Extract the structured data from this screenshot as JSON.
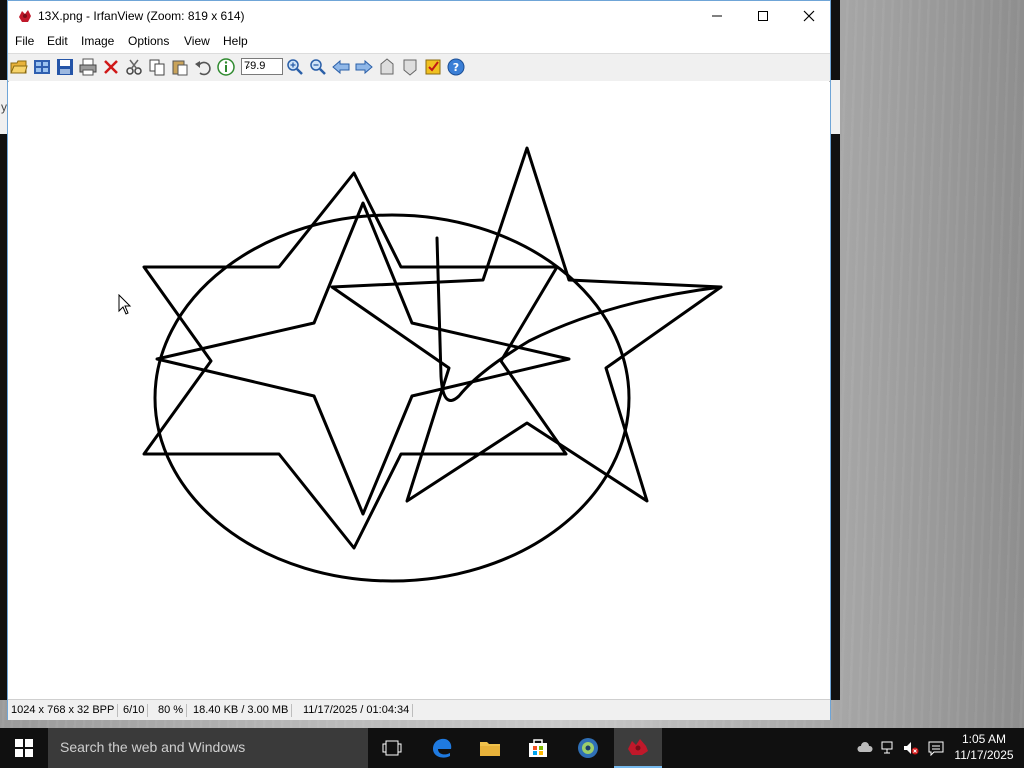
{
  "window": {
    "title": "13X.png - IrfanView (Zoom: 819 x 614)"
  },
  "menu": [
    "File",
    "Edit",
    "Image",
    "Options",
    "View",
    "Help"
  ],
  "toolbar": {
    "zoom_value": "79.9",
    "icons": [
      "open-icon",
      "thumbnails-icon",
      "save-icon",
      "print-icon",
      "delete-icon",
      "cut-icon",
      "copy-icon",
      "paste-icon",
      "undo-icon",
      "info-icon",
      "zoom-in-icon",
      "zoom-out-icon",
      "previous-icon",
      "next-icon",
      "first-icon",
      "last-icon",
      "paint-icon",
      "help-icon"
    ]
  },
  "status": {
    "dimensions": "1024 x 768 x 32 BPP",
    "index": "6/10",
    "zoom": "80 %",
    "size": "18.40 KB / 3.00 MB",
    "datetime": "11/17/2025 / 01:04:34"
  },
  "taskbar": {
    "search_placeholder": "Search the web and Windows",
    "time": "1:05 AM",
    "date": "11/17/2025"
  },
  "background_window": {
    "letter": "y"
  },
  "colors": {
    "taskbar": "#101010",
    "window_border": "#6fa5d7",
    "active_task_underline": "#76b9ed"
  }
}
